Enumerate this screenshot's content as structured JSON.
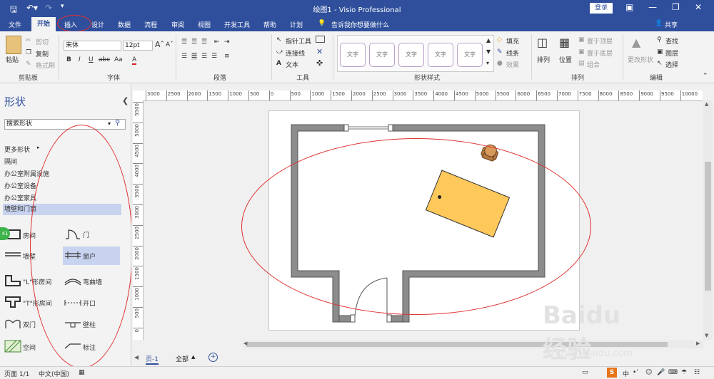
{
  "title_bar": {
    "title": "绘图1 - Visio Professional",
    "login": "登录"
  },
  "tabs": [
    "文件",
    "开始",
    "插入",
    "设计",
    "数据",
    "流程",
    "审阅",
    "视图",
    "开发工具",
    "帮助",
    "计划"
  ],
  "active_tab": "开始",
  "tell_me": "告诉我你想要做什么",
  "share": "共享",
  "ribbon": {
    "clipboard": {
      "paste": "粘贴",
      "cut": "剪切",
      "copy": "复制",
      "format_painter": "格式刷",
      "label": "剪贴板"
    },
    "font": {
      "name": "宋体",
      "size": "12pt",
      "label": "字体",
      "bold": "B",
      "italic": "I",
      "underline": "U",
      "strike": "abc",
      "case": "Aa",
      "color": "A"
    },
    "paragraph": {
      "label": "段落"
    },
    "tools": {
      "pointer": "指针工具",
      "connector": "连接线",
      "text": "文本",
      "label": "工具"
    },
    "shape_styles": {
      "sample": "文字",
      "fill": "填充",
      "line": "线条",
      "effect": "效果",
      "label": "形状样式"
    },
    "arrange": {
      "align": "排列",
      "position": "位置",
      "bring_front": "置于顶层",
      "send_back": "置于底层",
      "group": "组合",
      "label": "排列"
    },
    "editing": {
      "change_shape": "更改形状",
      "find": "查找",
      "layers": "图层",
      "select": "选择",
      "label": "编辑"
    }
  },
  "shapes_panel": {
    "title": "形状",
    "search_placeholder": "搜索形状",
    "more_shapes": "更多形状",
    "categories": [
      "隔间",
      "办公室附属设施",
      "办公室设备",
      "办公室家具",
      "墙壁和门窗"
    ],
    "selected_category": "墙壁和门窗",
    "stencils": [
      "房间",
      "门",
      "墙壁",
      "窗户",
      "\"L\"形房间",
      "弯曲墙",
      "\"T\"形房间",
      "开口",
      "双门",
      "壁柱",
      "空间",
      "标注"
    ]
  },
  "rulers": {
    "horizontal": [
      "3000",
      "2500",
      "2000",
      "1500",
      "1000",
      "500",
      "0",
      "500",
      "1000",
      "1500",
      "2000",
      "2500",
      "3000",
      "3500",
      "4000",
      "4500",
      "5000",
      "5500",
      "6000",
      "6500",
      "7000",
      "7500",
      "8000",
      "8500",
      "9000",
      "9500",
      "10000"
    ],
    "vertical": [
      "5500",
      "5000",
      "4500",
      "4000",
      "3500",
      "3000",
      "2500",
      "2000",
      "1500",
      "1000",
      "500",
      "0",
      "500"
    ]
  },
  "page_tabs": {
    "page": "页-1",
    "all": "全部",
    "add": "+"
  },
  "status_bar": {
    "page": "页面 1/1",
    "language": "中文(中国)"
  },
  "watermark": {
    "brand": "Baidu经验",
    "url": "jingyan.baidu.com"
  },
  "colors": {
    "brand": "#2f4f9c",
    "annotation": "#e03030",
    "desk": "#ffc85a",
    "chair": "#d89a5a"
  }
}
